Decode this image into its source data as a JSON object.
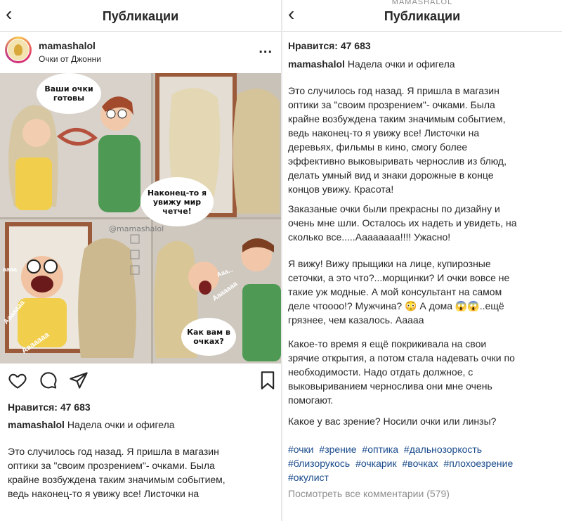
{
  "left": {
    "nav": {
      "back_icon": "chevron-left-icon",
      "title": "Публикации"
    },
    "post": {
      "username": "mamashalol",
      "location": "Очки от Джонни",
      "more_label": "...",
      "comic": {
        "bubble1": "Ваши очки готовы",
        "bubble2": "Наконец-то я увижу мир четче!",
        "bubble3": "Как вам в очках?",
        "watermark": "@mamashalol",
        "sound1": "аааа",
        "sound2": "Ааа...",
        "sound3": "Ааааааа",
        "sound4": "Ааааааа",
        "sound5": "Ааааааа"
      },
      "actions": {
        "like_icon": "heart-icon",
        "comment_icon": "comment-icon",
        "share_icon": "send-icon",
        "save_icon": "bookmark-icon"
      },
      "likes": "Нравится: 47 683",
      "caption_user": "mamashalol",
      "caption_text": "Надела очки и офигела",
      "body": "Это случилось год назад. Я пришла в магазин\nоптики за \"своим прозрением\"- очками. Была\nкрайне возбуждена таким значимым событием,\nведь наконец-то я увижу все! Листочки на"
    }
  },
  "right": {
    "nav": {
      "back_icon": "chevron-left-icon",
      "subtitle": "MAMASHALOL",
      "title": "Публикации"
    },
    "likes": "Нравится: 47 683",
    "caption_user": "mamashalol",
    "caption_text": "Надела очки и офигела",
    "paragraphs": [
      "Это случилось год назад. Я пришла в магазин\nоптики за \"своим прозрением\"- очками. Была\nкрайне возбуждена таким значимым событием,\nведь наконец-то я увижу все! Листочки на\nдеревьях, фильмы в кино, смогу более\nэффективно выковыривать чернослив из блюд,\nделать умный вид и знаки дорожные в конце\nконцов увижу. Красота!",
      "Заказаные очки были прекрасны по дизайну и\nочень мне шли. Осталось их надеть и увидеть, на\nсколько все.....Аааааааа!!!! Ужасно!",
      "Я вижу! Вижу прыщики на лице, купирозные\nсеточки, а это что?...морщинки? И очки вовсе не\nтакие уж модные. А мой консультант на самом\nделе чтоооо!? Мужчина? 😳  А дома 😱😱..ещё\nгрязнее, чем казалось. Ааааа",
      "Какое-то время я ещё покрикивала на свои\nзрячие открытия, а потом стала надевать очки по\nнеобходимости. Надо отдать должное, с\nвыковыриванием чернослива они мне очень\nпомогают.",
      "Какое у вас зрение? Носили очки или линзы?"
    ],
    "hashtags": [
      "#очки",
      "#зрение",
      "#оптика",
      "#дальнозоркость",
      "#близорукось",
      "#очкарик",
      "#вочках",
      "#плохоезрение",
      "#окулист"
    ],
    "view_comments": "Посмотреть все комментарии (579)"
  },
  "colors": {
    "link": "#1a4b8c",
    "muted": "#8e8e8e",
    "text": "#262626"
  }
}
